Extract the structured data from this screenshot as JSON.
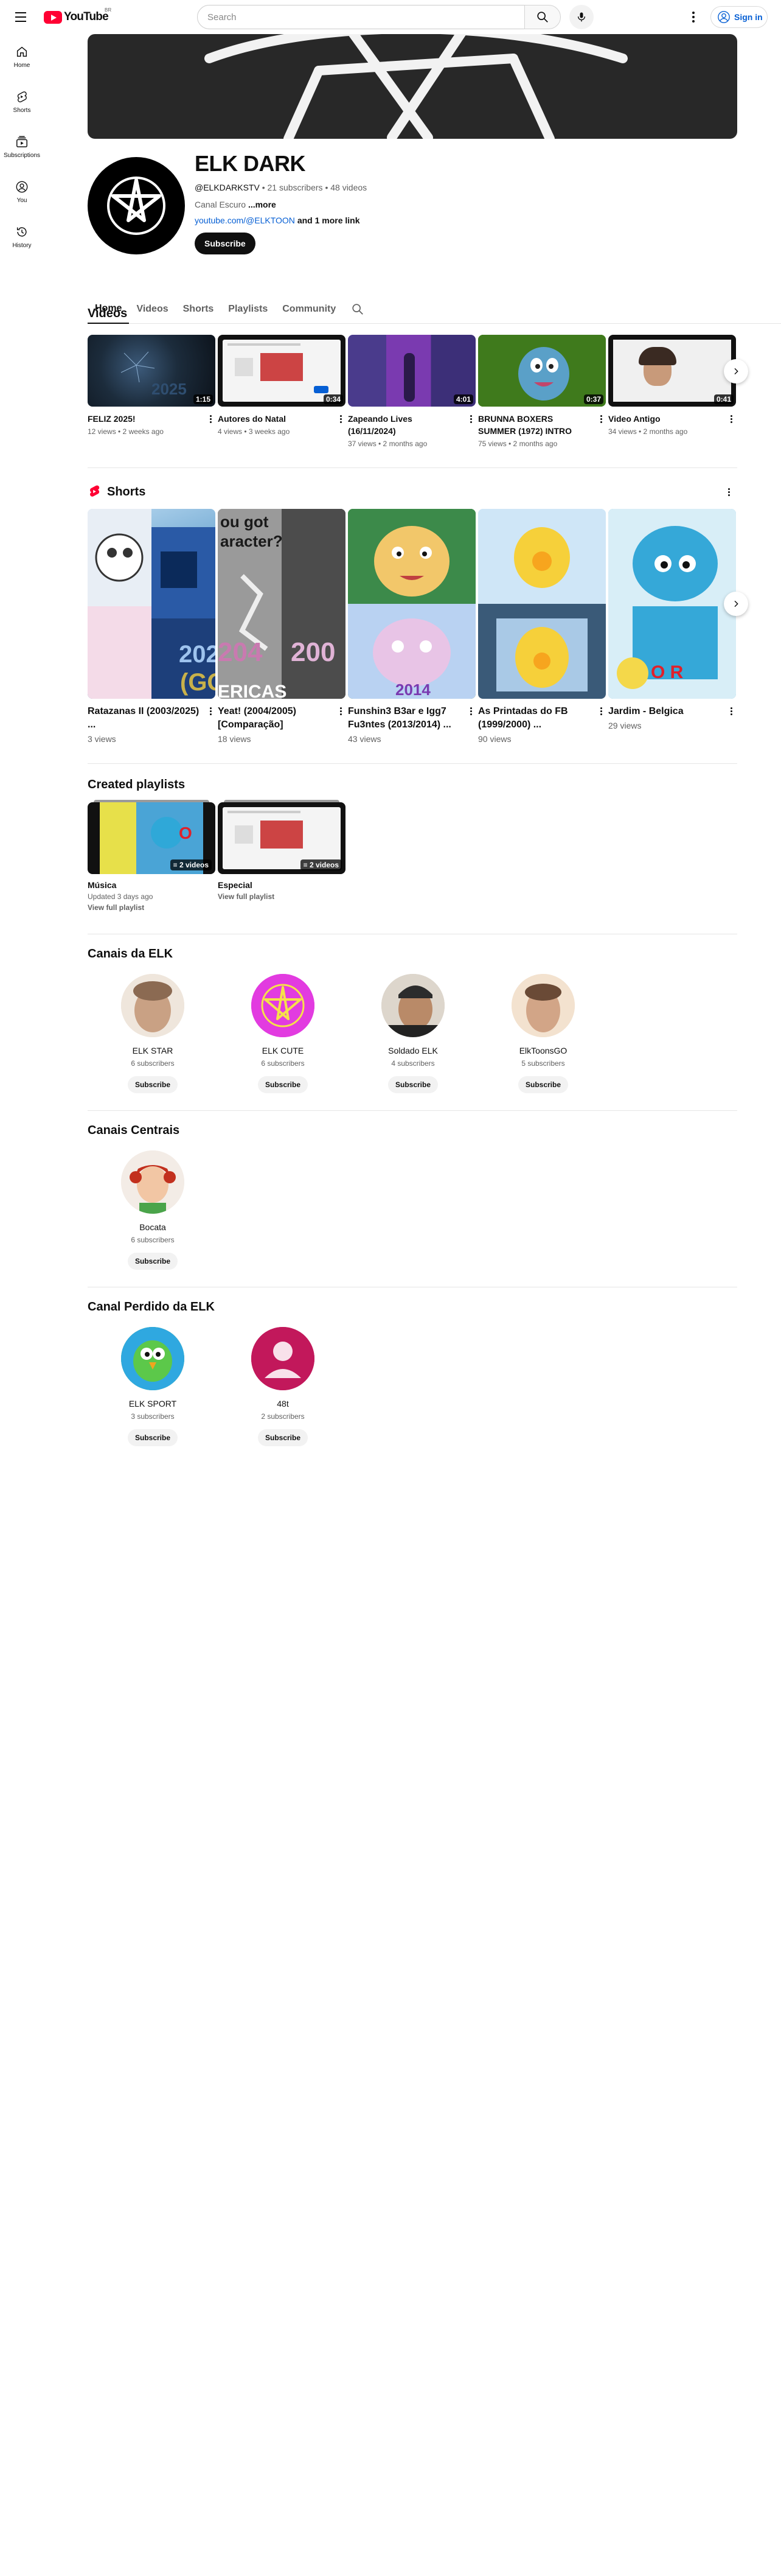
{
  "header": {
    "logo_text": "YouTube",
    "logo_country": "BR",
    "search_placeholder": "Search",
    "signin_label": "Sign in"
  },
  "rail": [
    {
      "label": "Home",
      "icon": "home-icon"
    },
    {
      "label": "Shorts",
      "icon": "shorts-icon"
    },
    {
      "label": "Subscriptions",
      "icon": "subscriptions-icon"
    },
    {
      "label": "You",
      "icon": "you-icon"
    },
    {
      "label": "History",
      "icon": "history-icon"
    }
  ],
  "channel": {
    "name": "ELK DARK",
    "handle": "@ELKDARKSTV",
    "subscribers": "21 subscribers",
    "videos": "48 videos",
    "description": "Canal Escuro",
    "more_label": "...more",
    "link": "youtube.com/@ELKTOON",
    "link_suffix": "and 1 more link",
    "subscribe_label": "Subscribe"
  },
  "tabs": [
    "Home",
    "Videos",
    "Shorts",
    "Playlists",
    "Community"
  ],
  "videos_section": {
    "title": "Videos",
    "items": [
      {
        "title": "FELIZ 2025!",
        "meta": "12 views • 2 weeks ago",
        "duration": "1:15"
      },
      {
        "title": "Autores do Natal",
        "meta": "4 views • 3 weeks ago",
        "duration": "0:34"
      },
      {
        "title": "Zapeando Lives (16/11/2024)",
        "meta": "37 views • 2 months ago",
        "duration": "4:01"
      },
      {
        "title": "BRUNNA BOXERS SUMMER (1972) INTRO",
        "meta": "75 views • 2 months ago",
        "duration": "0:37"
      },
      {
        "title": "Video Antigo",
        "meta": "34 views • 2 months ago",
        "duration": "0:41"
      }
    ]
  },
  "shorts_section": {
    "title": "Shorts",
    "items": [
      {
        "title": "Ratazanas II (2003/2025) ...",
        "meta": "3 views",
        "overlay": "202 (GO"
      },
      {
        "title": "Yeat! (2004/2005) [Comparação]",
        "meta": "18 views",
        "overlay": "ou got aracter?"
      },
      {
        "title": "Funshin3 B3ar e Igg7 Fu3ntes (2013/2014) ...",
        "meta": "43 views",
        "overlay": "2014"
      },
      {
        "title": "As Printadas do FB (1999/2000) ...",
        "meta": "90 views",
        "overlay": ""
      },
      {
        "title": "Jardim - Belgica",
        "meta": "29 views",
        "overlay": "O R"
      }
    ]
  },
  "playlists_section": {
    "title": "Created playlists",
    "items": [
      {
        "title": "Música",
        "meta": "Updated 3 days ago",
        "link": "View full playlist",
        "count": "2 videos"
      },
      {
        "title": "Especial",
        "meta": "",
        "link": "View full playlist",
        "count": "2 videos"
      }
    ]
  },
  "channels_sections": [
    {
      "title": "Canais da ELK",
      "items": [
        {
          "name": "ELK STAR",
          "subs": "6 subscribers",
          "button": "Subscribe"
        },
        {
          "name": "ELK CUTE",
          "subs": "6 subscribers",
          "button": "Subscribe"
        },
        {
          "name": "Soldado ELK",
          "subs": "4 subscribers",
          "button": "Subscribe"
        },
        {
          "name": "ElkToonsGO",
          "subs": "5 subscribers",
          "button": "Subscribe"
        }
      ]
    },
    {
      "title": "Canais Centrais",
      "items": [
        {
          "name": "Bocata",
          "subs": "6 subscribers",
          "button": "Subscribe"
        }
      ]
    },
    {
      "title": "Canal Perdido da ELK",
      "items": [
        {
          "name": "ELK SPORT",
          "subs": "3 subscribers",
          "button": "Subscribe"
        },
        {
          "name": "48t",
          "subs": "2 subscribers",
          "button": "Subscribe"
        }
      ]
    }
  ],
  "colors": {
    "brand_red": "#ff0033",
    "link_blue": "#065fd4",
    "text_primary": "#0f0f0f",
    "text_secondary": "#606060"
  }
}
